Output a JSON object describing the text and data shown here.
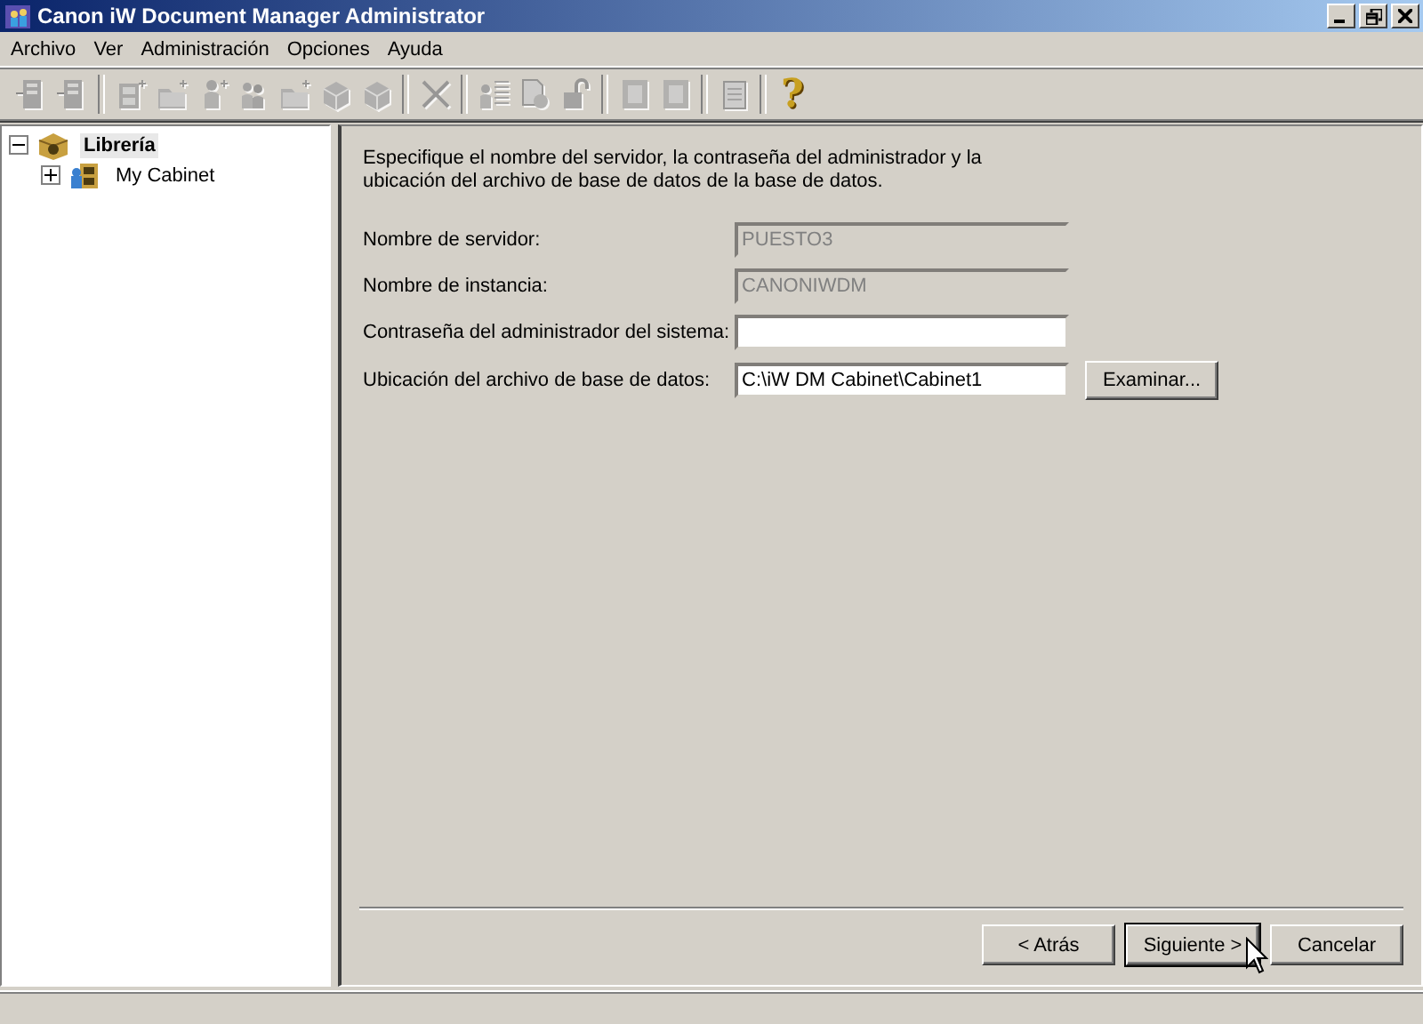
{
  "window": {
    "title": "Canon iW Document Manager Administrator"
  },
  "menu": [
    "Archivo",
    "Ver",
    "Administración",
    "Opciones",
    "Ayuda"
  ],
  "toolbar": [
    [
      {
        "disabled": true
      },
      {
        "disabled": true
      }
    ],
    [
      {
        "disabled": true
      },
      {
        "disabled": true
      },
      {
        "disabled": true
      },
      {
        "disabled": true
      },
      {
        "disabled": true
      },
      {
        "disabled": true
      },
      {
        "disabled": true
      }
    ],
    [
      {
        "disabled": true
      }
    ],
    [
      {
        "disabled": true
      },
      {
        "disabled": true
      },
      {
        "disabled": true
      }
    ],
    [
      {
        "disabled": true
      },
      {
        "disabled": true
      }
    ],
    [
      {
        "disabled": true
      }
    ],
    [
      {
        "disabled": false,
        "glyph": "?"
      }
    ]
  ],
  "tree": [
    {
      "label": "Librería",
      "expanded": true,
      "selected": true,
      "children": [
        {
          "label": "My Cabinet",
          "expanded": false,
          "selected": false
        }
      ]
    }
  ],
  "panel": {
    "intro": "Especifique el nombre del servidor, la contraseña del administrador y la ubicación del archivo de base de datos de la base de datos.",
    "fields": [
      {
        "label": "Nombre de servidor:",
        "value": "PUESTO3",
        "disabled": true
      },
      {
        "label": "Nombre de instancia:",
        "value": "CANONIWDM",
        "disabled": true
      },
      {
        "label": "Contraseña del administrador del sistema:",
        "disabled": false
      },
      {
        "label": "Ubicación del archivo de base de datos:",
        "value": "C:\\iW DM Cabinet\\Cabinet1",
        "disabled": false,
        "browse": "Examinar..."
      }
    ],
    "buttons": [
      {
        "label": "< Atrás",
        "default": false
      },
      {
        "label": "Siguiente >",
        "default": true
      },
      {
        "label": "Cancelar",
        "default": false
      }
    ]
  }
}
